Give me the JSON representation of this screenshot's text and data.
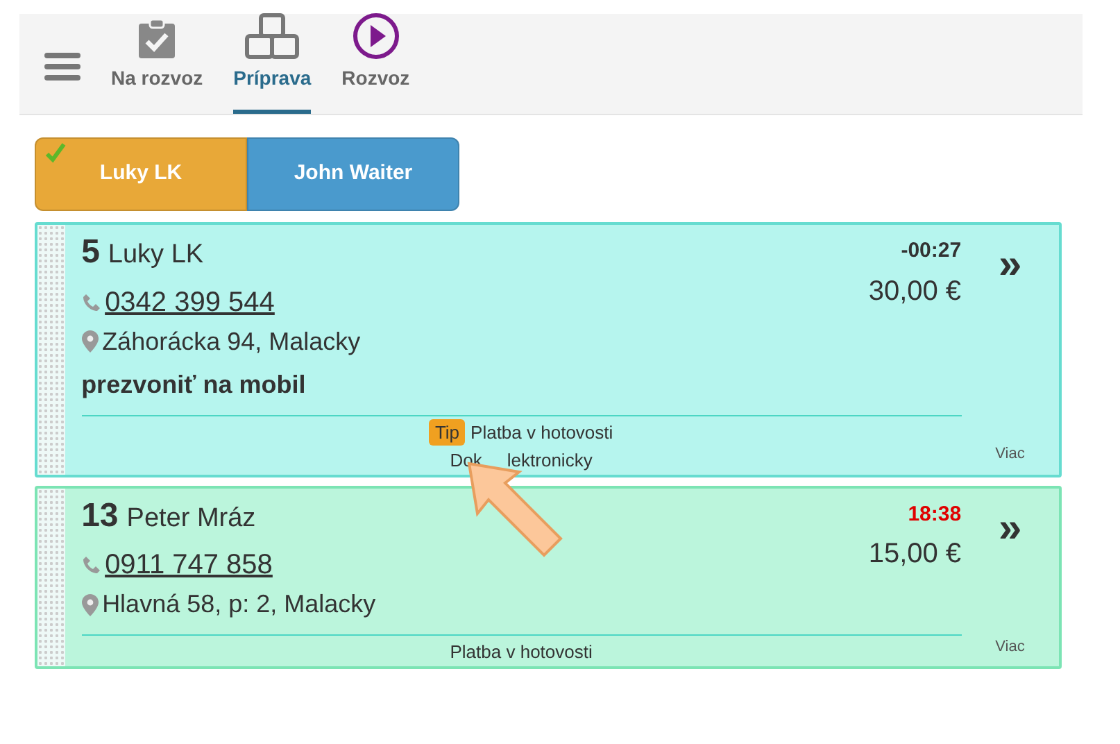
{
  "tabs": [
    {
      "label": "Na rozvoz",
      "kind": "clipboard",
      "selected": false
    },
    {
      "label": "Príprava",
      "kind": "boxes",
      "selected": true
    },
    {
      "label": "Rozvoz",
      "kind": "play",
      "selected": false
    }
  ],
  "couriers": [
    {
      "label": "Luky LK",
      "color": "#e8a838",
      "selected": true
    },
    {
      "label": "John Waiter",
      "color": "#4a9acd",
      "selected": false
    }
  ],
  "orders": [
    {
      "number": "5",
      "name": "Luky LK",
      "phone": "0342 399 544",
      "address": "Záhorácka 94, Malacky",
      "note": "prezvoniť na mobil",
      "time": "-00:27",
      "time_alert": false,
      "price": "30,00 €",
      "color": "#b6f5ee",
      "tip": "Tip",
      "payment_lines": [
        [
          "Platba v hotovosti"
        ],
        [
          "Dok",
          "lektronicky"
        ]
      ],
      "forward": "»",
      "more": "Viac"
    },
    {
      "number": "13",
      "name": "Peter Mráz",
      "phone": "0911 747 858",
      "address": "Hlavná 58, p: 2, Malacky",
      "time": "18:38",
      "time_alert": true,
      "price": "15,00 €",
      "color": "#bbf5dc",
      "payment_lines": [
        [
          "Platba v hotovosti"
        ]
      ],
      "forward": "»",
      "more": "Viac"
    }
  ]
}
